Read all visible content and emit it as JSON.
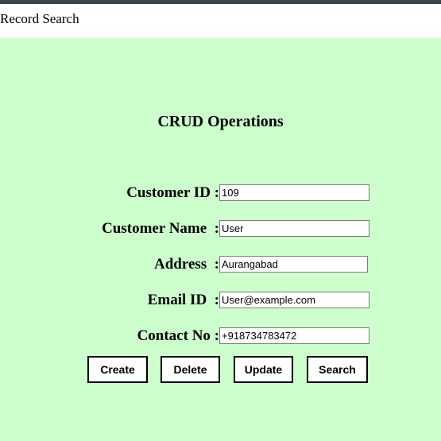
{
  "browser": {
    "chrome_bar_color": "#3a424c"
  },
  "header": {
    "title": "Record Search"
  },
  "page": {
    "background_color": "#ccffcc",
    "title": "CRUD Operations"
  },
  "form": {
    "fields": [
      {
        "id": "customer-id",
        "label": "Customer ID :",
        "value": "109",
        "placeholder": ""
      },
      {
        "id": "customer-name",
        "label": "Customer Name  :",
        "value": "User",
        "placeholder": ""
      },
      {
        "id": "address",
        "label": "Address  :",
        "value": "Aurangabad",
        "placeholder": ""
      },
      {
        "id": "email-id",
        "label": "Email ID  :",
        "value": "User@example.com",
        "placeholder": ""
      },
      {
        "id": "contact-no",
        "label": "Contact No :",
        "value": "+918734783472",
        "placeholder": ""
      }
    ]
  },
  "buttons": {
    "create": "Create",
    "delete": "Delete",
    "update": "Update",
    "search": "Search"
  }
}
